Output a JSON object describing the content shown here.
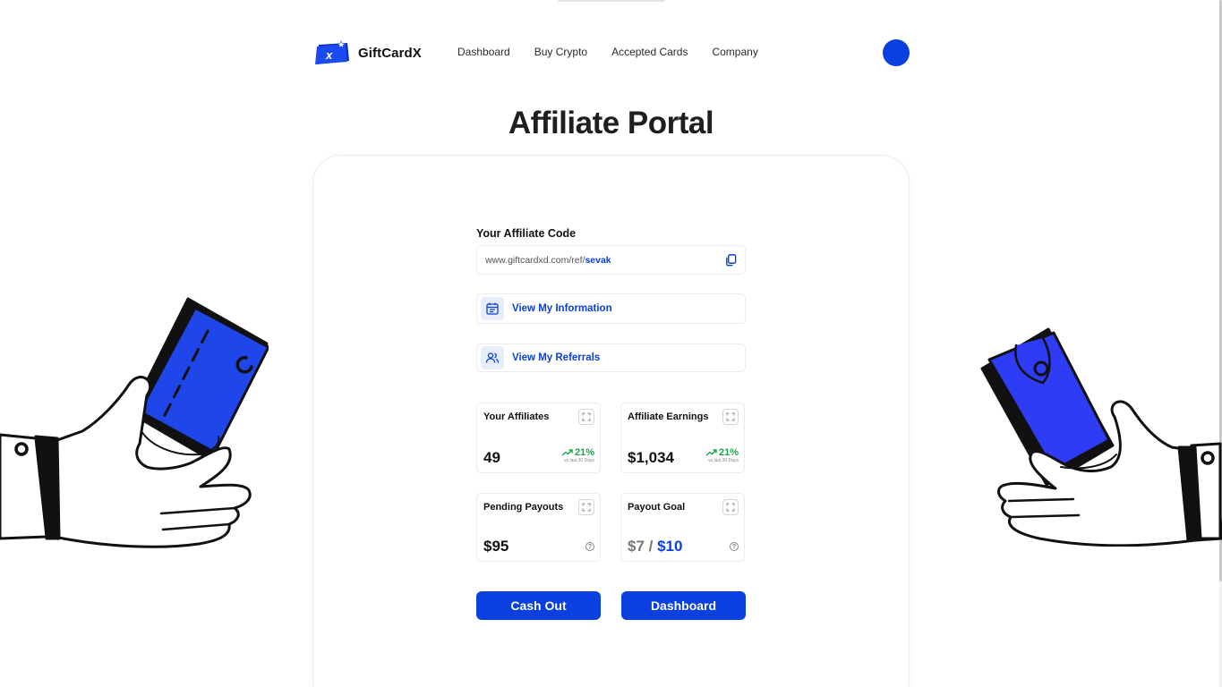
{
  "header": {
    "brand": "GiftCardX",
    "nav": [
      "Dashboard",
      "Buy Crypto",
      "Accepted Cards",
      "Company"
    ]
  },
  "page": {
    "title": "Affiliate Portal"
  },
  "affiliate": {
    "code_label": "Your Affiliate Code",
    "link_base": "www.giftcardxd.com/ref/",
    "link_user": "sevak"
  },
  "links": {
    "info": "View My Information",
    "referrals": "View My Referrals"
  },
  "stats": {
    "affiliates": {
      "title": "Your Affiliates",
      "value": "49",
      "trend": "21%",
      "trend_sub": "vs last 30 Days"
    },
    "earnings": {
      "title": "Affiliate Earnings",
      "value": "$1,034",
      "trend": "21%",
      "trend_sub": "vs last 30 Days"
    },
    "pending": {
      "title": "Pending Payouts",
      "value": "$95",
      "help": "?"
    },
    "goal": {
      "title": "Payout Goal",
      "current": "$7",
      "separator": " / ",
      "target": "$10",
      "help": "?"
    }
  },
  "buttons": {
    "cash_out": "Cash Out",
    "dashboard": "Dashboard"
  },
  "colors": {
    "accent": "#0a3fe0",
    "positive": "#1ea04a",
    "card_blue": "#2f3cf5"
  },
  "icons": [
    "copy-icon",
    "calendar-icon",
    "users-icon",
    "expand-icon",
    "trend-up-icon",
    "help-icon"
  ]
}
